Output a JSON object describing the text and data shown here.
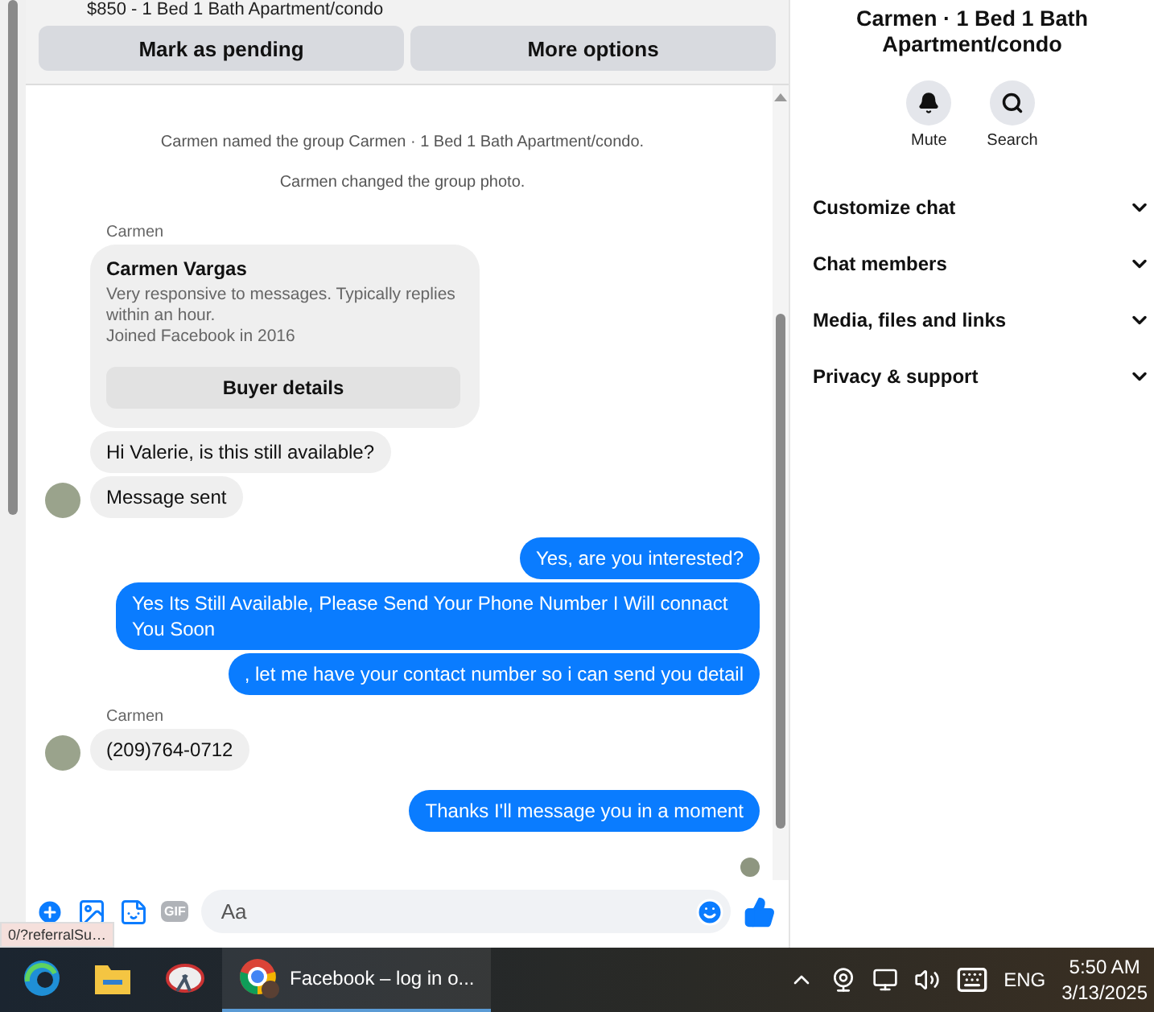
{
  "listing": {
    "title": "$850 - 1 Bed 1 Bath Apartment/condo"
  },
  "actions": [
    "Mark as pending",
    "More options"
  ],
  "messages": [
    {
      "kind": "notice",
      "text": "Carmen named the group Carmen · 1 Bed 1 Bath Apartment/condo."
    },
    {
      "kind": "notice",
      "text": "Carmen changed the group photo."
    },
    {
      "kind": "sender",
      "text": "Carmen"
    },
    {
      "kind": "profile_card",
      "name": "Carmen Vargas",
      "lines": [
        "Very responsive to messages. Typically replies within an hour.",
        "Joined Facebook in 2016"
      ],
      "button": "Buyer details"
    },
    {
      "kind": "incoming",
      "text": "Hi Valerie, is this still available?",
      "avatar": false
    },
    {
      "kind": "incoming",
      "text": "Message sent",
      "avatar": true
    },
    {
      "kind": "outgoing",
      "text": "Yes, are you interested?"
    },
    {
      "kind": "outgoing",
      "text": "Yes Its Still Available, Please Send Your Phone Number I Will connact You Soon"
    },
    {
      "kind": "outgoing",
      "text": ", let me have your contact number so i can send you detail"
    },
    {
      "kind": "sender",
      "text": "Carmen"
    },
    {
      "kind": "incoming",
      "text": "(209)764-0712",
      "avatar": true
    },
    {
      "kind": "outgoing",
      "text": "Thanks I'll message you in a moment"
    },
    {
      "kind": "seen"
    }
  ],
  "composer": {
    "gif_label": "GIF",
    "placeholder": "Aa"
  },
  "status_link": "0/?referralSu…",
  "details": {
    "title": "Carmen · 1 Bed 1 Bath Apartment/condo",
    "quick_actions": [
      {
        "kind": "mute",
        "label": "Mute"
      },
      {
        "kind": "search",
        "label": "Search"
      }
    ],
    "sections": [
      {
        "label": "Customize chat",
        "expanded": false
      },
      {
        "label": "Chat members",
        "expanded": false
      },
      {
        "label": "Media, files and links",
        "expanded": false
      },
      {
        "label": "Privacy & support",
        "expanded": false
      }
    ]
  },
  "taskbar": {
    "apps": [
      {
        "kind": "edge",
        "selected": false
      },
      {
        "kind": "explorer",
        "selected": false
      },
      {
        "kind": "snip",
        "selected": false
      },
      {
        "kind": "chrome",
        "label": "Facebook – log in o...",
        "selected": true
      }
    ],
    "language": "ENG",
    "time": "5:50 AM",
    "date": "3/13/2025"
  }
}
